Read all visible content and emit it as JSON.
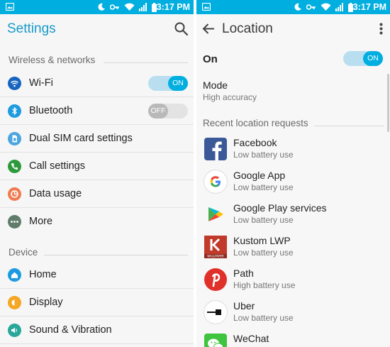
{
  "status_bar": {
    "time": "3:17 PM"
  },
  "left": {
    "title": "Settings",
    "sections": [
      {
        "header": "Wireless & networks"
      },
      {
        "header": "Device"
      }
    ],
    "items": [
      {
        "label": "Wi-Fi",
        "icon": "wifi-icon",
        "color": "#1565c0",
        "toggle": "ON"
      },
      {
        "label": "Bluetooth",
        "icon": "bluetooth-icon",
        "color": "#1e9be0",
        "toggle": "OFF"
      },
      {
        "label": "Dual SIM card settings",
        "icon": "sim-card-icon",
        "color": "#4aa5e0"
      },
      {
        "label": "Call settings",
        "icon": "phone-icon",
        "color": "#2e9a3c"
      },
      {
        "label": "Data usage",
        "icon": "data-usage-icon",
        "color": "#ef7b4f"
      },
      {
        "label": "More",
        "icon": "more-icon",
        "color": "#607d6b"
      },
      {
        "label": "Home",
        "icon": "home-icon",
        "color": "#1e9be0"
      },
      {
        "label": "Display",
        "icon": "display-icon",
        "color": "#f5a623"
      },
      {
        "label": "Sound & Vibration",
        "icon": "sound-icon",
        "color": "#28a79a"
      }
    ]
  },
  "right": {
    "title": "Location",
    "on_label": "On",
    "on_toggle": "ON",
    "mode_label": "Mode",
    "mode_value": "High accuracy",
    "recent_header": "Recent location requests",
    "apps": [
      {
        "name": "Facebook",
        "usage": "Low battery use",
        "icon": "facebook-icon",
        "color": "#3b5998"
      },
      {
        "name": "Google App",
        "usage": "Low battery use",
        "icon": "google-icon",
        "color": "#ffffff"
      },
      {
        "name": "Google Play services",
        "usage": "Low battery use",
        "icon": "google-play-services-icon",
        "color": "#ffffff"
      },
      {
        "name": "Kustom LWP",
        "usage": "Low battery use",
        "icon": "kustom-lwp-icon",
        "color": "#c0392b",
        "icon_caption": "WALLPAPER"
      },
      {
        "name": "Path",
        "usage": "High battery use",
        "icon": "path-icon",
        "color": "#e0302a"
      },
      {
        "name": "Uber",
        "usage": "Low battery use",
        "icon": "uber-icon",
        "color": "#ffffff"
      },
      {
        "name": "WeChat",
        "usage": "",
        "icon": "wechat-icon",
        "color": "#3ec43e"
      }
    ]
  }
}
